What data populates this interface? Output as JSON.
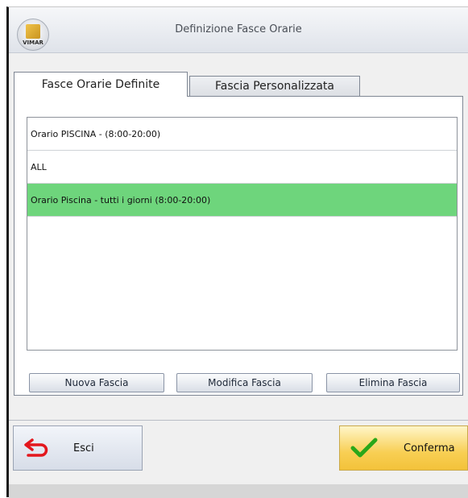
{
  "window": {
    "title": "Definizione Fasce Orarie",
    "logo_text": "VIMAR"
  },
  "tabs": [
    {
      "label": "Fasce Orarie Definite",
      "active": true
    },
    {
      "label": "Fascia Personalizzata",
      "active": false
    }
  ],
  "list": {
    "items": [
      {
        "label": "Orario PISCINA  -  (8:00-20:00)",
        "selected": false
      },
      {
        "label": "ALL",
        "selected": false
      },
      {
        "label": "Orario Piscina - tutti i giorni (8:00-20:00)",
        "selected": true
      }
    ],
    "selected_color": "#6ed57c"
  },
  "buttons": {
    "new": "Nuova Fascia",
    "edit": "Modifica Fascia",
    "delete": "Elimina Fascia"
  },
  "footer": {
    "exit": "Esci",
    "confirm": "Conferma"
  },
  "icons": {
    "exit": "return-arrow-icon",
    "confirm": "checkmark-icon"
  }
}
